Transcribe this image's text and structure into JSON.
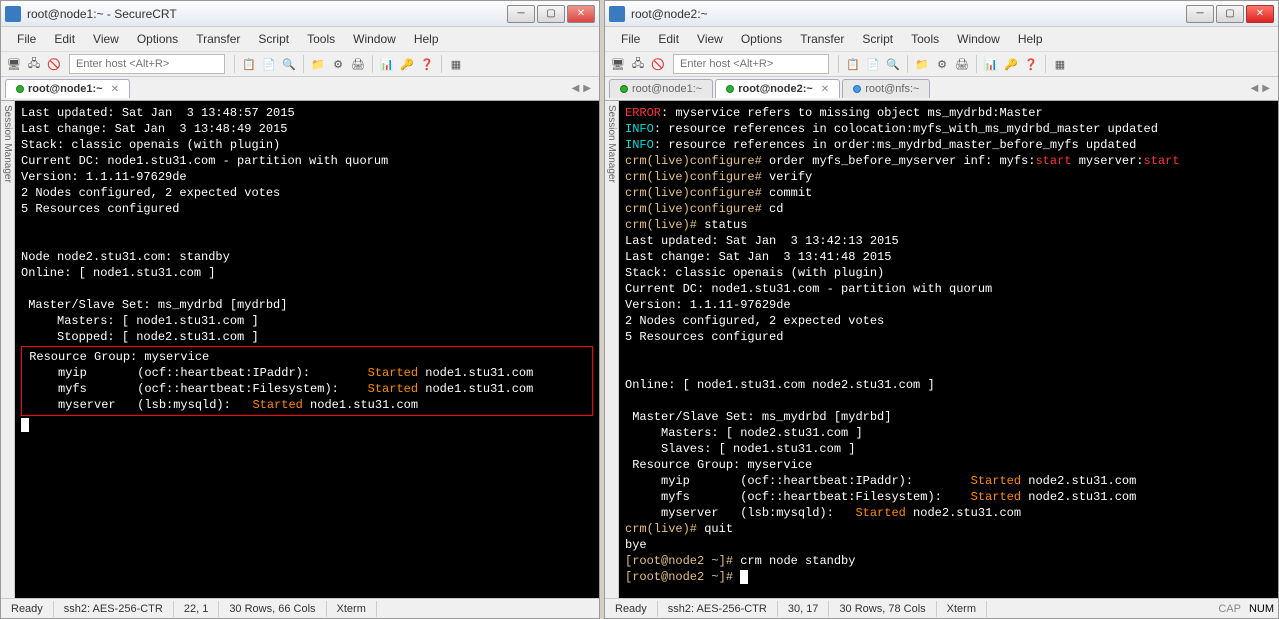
{
  "left": {
    "title": "root@node1:~ - SecureCRT",
    "menus": [
      "File",
      "Edit",
      "View",
      "Options",
      "Transfer",
      "Script",
      "Tools",
      "Window",
      "Help"
    ],
    "host_placeholder": "Enter host <Alt+R>",
    "tabs": [
      {
        "label": "root@node1:~",
        "active": true
      }
    ],
    "session_mgr": "Session Manager",
    "status": {
      "ready": "Ready",
      "cipher": "ssh2: AES-256-CTR",
      "pos": "22,  1",
      "size": "30 Rows, 66 Cols",
      "term": "Xterm"
    },
    "term": {
      "l1": "Last updated: Sat Jan  3 13:48:57 2015",
      "l2": "Last change: Sat Jan  3 13:48:49 2015",
      "l3": "Stack: classic openais (with plugin)",
      "l4": "Current DC: node1.stu31.com - partition with quorum",
      "l5": "Version: 1.1.11-97629de",
      "l6": "2 Nodes configured, 2 expected votes",
      "l7": "5 Resources configured",
      "n1": "Node node2.stu31.com: standby",
      "n2": "Online: [ node1.stu31.com ]",
      "m1": " Master/Slave Set: ms_mydrbd [mydrbd]",
      "m2": "     Masters: [ node1.stu31.com ]",
      "m3": "     Stopped: [ node2.stu31.com ]",
      "rg": " Resource Group: myservice",
      "r1a": "     myip       (ocf::heartbeat:IPaddr):        ",
      "r1b": "Started",
      "r1c": " node1.stu31.com",
      "r2a": "     myfs       (ocf::heartbeat:Filesystem):    ",
      "r2b": "Started",
      "r2c": " node1.stu31.com",
      "r3a": "     myserver   (lsb:mysqld):   ",
      "r3b": "Started",
      "r3c": " node1.stu31.com"
    }
  },
  "right": {
    "title": "root@node2:~",
    "menus": [
      "File",
      "Edit",
      "View",
      "Options",
      "Transfer",
      "Script",
      "Tools",
      "Window",
      "Help"
    ],
    "host_placeholder": "Enter host <Alt+R>",
    "tabs": [
      {
        "label": "root@node1:~",
        "active": false
      },
      {
        "label": "root@node2:~",
        "active": true
      },
      {
        "label": "root@nfs:~",
        "active": false
      }
    ],
    "session_mgr": "Session Manager",
    "status": {
      "ready": "Ready",
      "cipher": "ssh2: AES-256-CTR",
      "pos": "30,  17",
      "size": "30 Rows, 78 Cols",
      "term": "Xterm",
      "cap": "CAP",
      "num": "NUM"
    },
    "term": {
      "e1a": "ERROR",
      "e1b": ": myservice refers to missing object ms_mydrbd:Master",
      "i1a": "INFO",
      "i1b": ": resource references in colocation:myfs_with_ms_mydrbd_master updated",
      "i2a": "INFO",
      "i2b": ": resource references in order:ms_mydrbd_master_before_myfs updated",
      "p1": "crm(live)configure#",
      "c1a": " order myfs_before_myserver inf: myfs:",
      "c1s": "start",
      "c1b": " myserver:",
      "c1s2": "start",
      "p2": "crm(live)configure#",
      "c2": " verify",
      "p3": "crm(live)configure#",
      "c3": " commit",
      "p4": "crm(live)configure#",
      "c4": " cd",
      "p5": "crm(live)#",
      "c5": " status",
      "l1": "Last updated: Sat Jan  3 13:42:13 2015",
      "l2": "Last change: Sat Jan  3 13:41:48 2015",
      "l3": "Stack: classic openais (with plugin)",
      "l4": "Current DC: node1.stu31.com - partition with quorum",
      "l5": "Version: 1.1.11-97629de",
      "l6": "2 Nodes configured, 2 expected votes",
      "l7": "5 Resources configured",
      "o1": "Online: [ node1.stu31.com node2.stu31.com ]",
      "m1": " Master/Slave Set: ms_mydrbd [mydrbd]",
      "m2": "     Masters: [ node2.stu31.com ]",
      "m3": "     Slaves: [ node1.stu31.com ]",
      "rg": " Resource Group: myservice",
      "r1a": "     myip       (ocf::heartbeat:IPaddr):        ",
      "r1b": "Started",
      "r1c": " node2.stu31.com",
      "r2a": "     myfs       (ocf::heartbeat:Filesystem):    ",
      "r2b": "Started",
      "r2c": " node2.stu31.com",
      "r3a": "     myserver   (lsb:mysqld):   ",
      "r3b": "Started",
      "r3c": " node2.stu31.com",
      "p6": "crm(live)#",
      "c6": " quit",
      "bye": "bye",
      "sh1": "[root@node2 ~]#",
      "sc1": " crm node standby",
      "sh2": "[root@node2 ~]#",
      "sc2": " "
    }
  }
}
